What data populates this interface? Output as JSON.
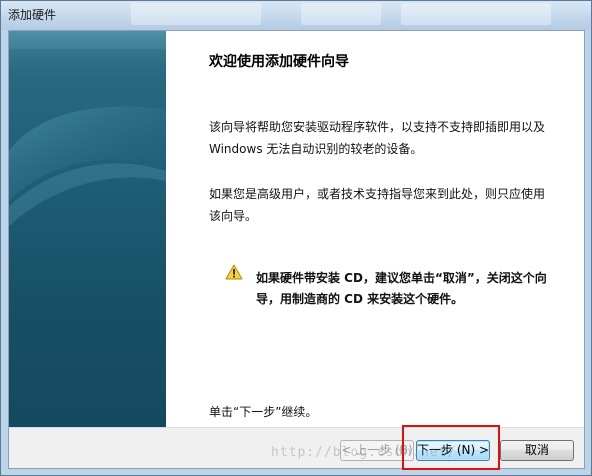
{
  "window": {
    "title": "添加硬件"
  },
  "wizard": {
    "heading": "欢迎使用添加硬件向导",
    "intro_lines": [
      "该向导将帮助您安装驱动程序软件，以支持不支持即插即用以及",
      "Windows 无法自动识别的较老的设备。"
    ],
    "advanced_lines": [
      "如果您是高级用户，或者技术支持指导您来到此处，则只应使用",
      "该向导。"
    ],
    "warning": {
      "icon": "warning-triangle-icon",
      "lines": [
        "如果硬件带安装 CD，建议您单击“取消”，关闭这个向",
        "导，用制造商的 CD 来安装这个硬件。"
      ]
    },
    "continue_text": "单击“下一步”继续。"
  },
  "buttons": {
    "back": "< 上一步 (B)",
    "next": "下一步 (N) >",
    "cancel": "取消"
  },
  "watermark": "http://blog.csdn.net/",
  "colors": {
    "sidebar": "#1f5f77",
    "highlight": "#e01010",
    "next_button_border": "#3c7fb1"
  }
}
